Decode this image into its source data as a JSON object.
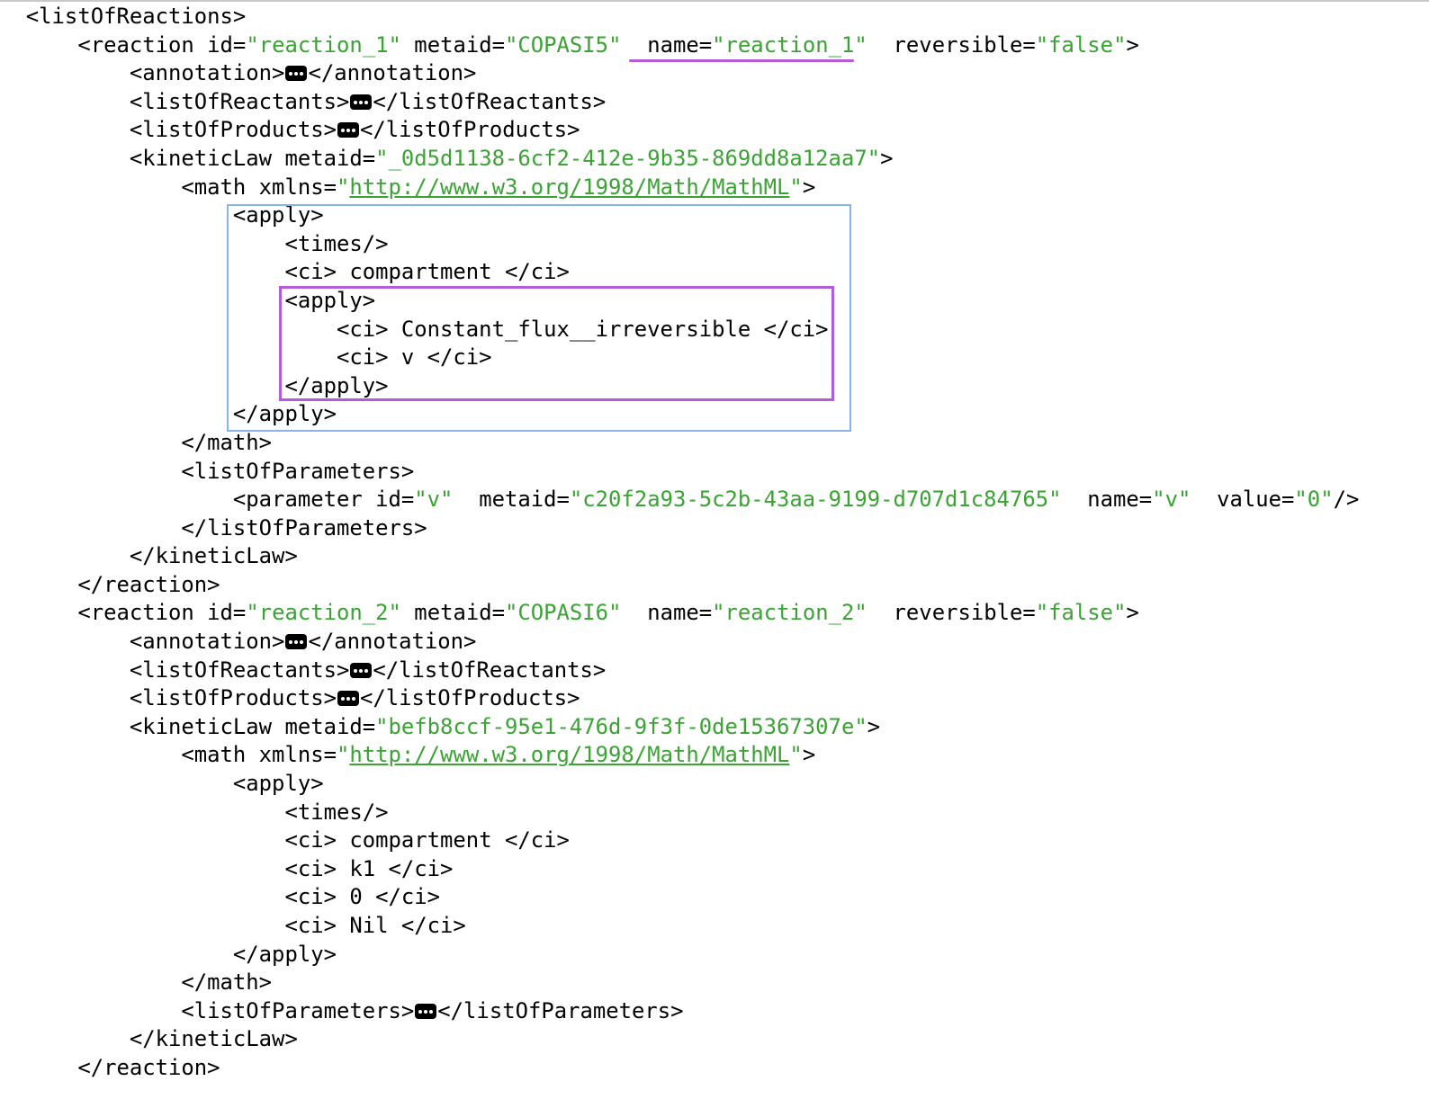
{
  "xml": {
    "list_open": "<listOfReactions>",
    "reactions": [
      {
        "open": {
          "tag": "<reaction ",
          "id_key": "id=",
          "id_val": "\"reaction_1\"",
          "metaid_key": " metaid=",
          "metaid_val": "\"COPASI5\"",
          "name_key": "name=",
          "name_val": "\"reaction_1\"",
          "rev_key": " reversible=",
          "rev_val": "\"false\"",
          "end": ">"
        },
        "annotation_open": "<annotation>",
        "annotation_close": "</annotation>",
        "reactants_open": "<listOfReactants>",
        "reactants_close": "</listOfReactants>",
        "products_open": "<listOfProducts>",
        "products_close": "</listOfProducts>",
        "kinetic_key": "<kineticLaw metaid=",
        "kinetic_val": "\"_0d5d1138-6cf2-412e-9b35-869dd8a12aa7\"",
        "kinetic_end": ">",
        "math_key": "<math xmlns=",
        "math_q1": "\"",
        "math_url": "http://www.w3.org/1998/Math/MathML",
        "math_q2": "\"",
        "math_end": ">",
        "apply_open": "<apply>",
        "times": "<times/>",
        "ci_compartment": "<ci> compartment </ci>",
        "inner_apply_open": "<apply>",
        "ci_constant_flux": "<ci> Constant_flux__irreversible </ci>",
        "ci_v": "<ci> v </ci>",
        "inner_apply_close": "</apply>",
        "apply_close": "</apply>",
        "math_close": "</math>",
        "params_open": "<listOfParameters>",
        "param": {
          "tag": "<parameter id=",
          "id_val": "\"v\"",
          "metaid_key": " metaid=",
          "metaid_val": "\"c20f2a93-5c2b-43aa-9199-d707d1c84765\"",
          "name_key": " name=",
          "name_val": "\"v\"",
          "value_key": " value=",
          "value_val": "\"0\"",
          "end": "/>"
        },
        "params_close": "</listOfParameters>",
        "kinetic_close": "</kineticLaw>",
        "close": "</reaction>"
      },
      {
        "open": {
          "tag": "<reaction ",
          "id_key": "id=",
          "id_val": "\"reaction_2\"",
          "metaid_key": " metaid=",
          "metaid_val": "\"COPASI6\"",
          "name_key": " name=",
          "name_val": "\"reaction_2\"",
          "rev_key": " reversible=",
          "rev_val": "\"false\"",
          "end": ">"
        },
        "annotation_open": "<annotation>",
        "annotation_close": "</annotation>",
        "reactants_open": "<listOfReactants>",
        "reactants_close": "</listOfReactants>",
        "products_open": "<listOfProducts>",
        "products_close": "</listOfProducts>",
        "kinetic_key": "<kineticLaw metaid=",
        "kinetic_val": "\"befb8ccf-95e1-476d-9f3f-0de15367307e\"",
        "kinetic_end": ">",
        "math_key": "<math xmlns=",
        "math_q1": "\"",
        "math_url": "http://www.w3.org/1998/Math/MathML",
        "math_q2": "\"",
        "math_end": ">",
        "apply_open": "<apply>",
        "times": "<times/>",
        "ci_compartment": "<ci> compartment </ci>",
        "ci_k1": "<ci> k1 </ci>",
        "ci_0": "<ci> 0 </ci>",
        "ci_nil": "<ci> Nil </ci>",
        "apply_close": "</apply>",
        "math_close": "</math>",
        "params_open": "<listOfParameters>",
        "params_close": "</listOfParameters>",
        "kinetic_close": "</kineticLaw>",
        "close": "</reaction>"
      }
    ]
  },
  "colors": {
    "attribute_value": "#3aa334",
    "highlight_outer_box": "#8ab4e8",
    "highlight_inner_box": "#b45bdc",
    "highlight_underline": "#b45bdc"
  },
  "icons": {
    "collapsed": "ellipsis-icon"
  }
}
